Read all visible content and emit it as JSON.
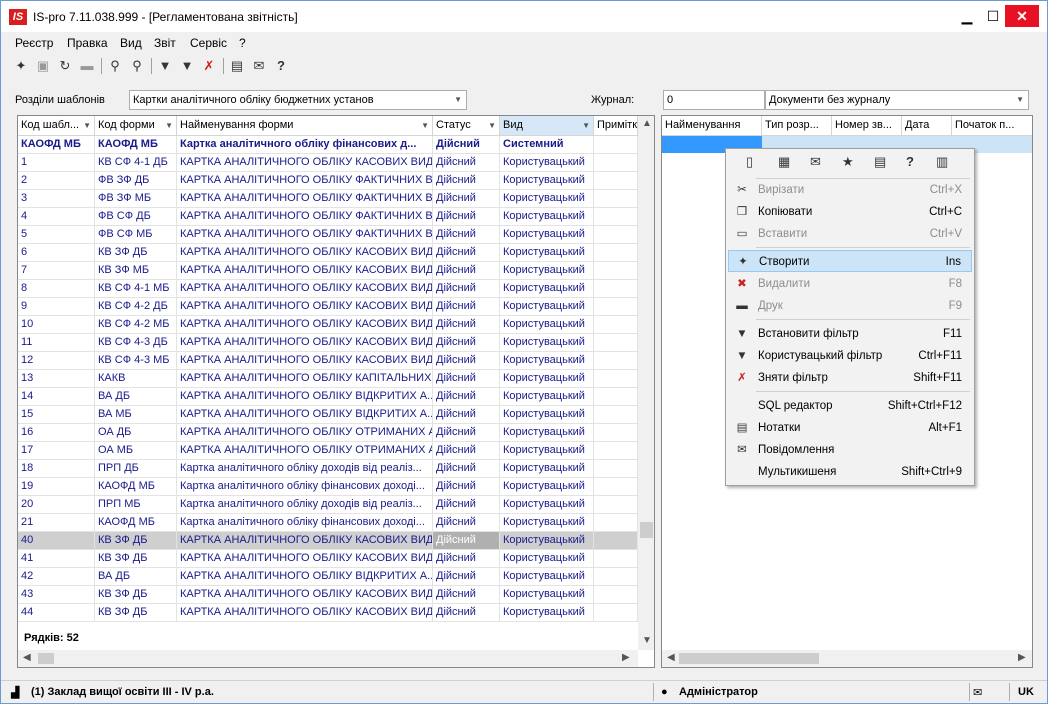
{
  "window": {
    "title": "IS-pro 7.11.038.999 - [Регламентована звітність]",
    "app_icon": "IS"
  },
  "menu": [
    "Реєстр",
    "Правка",
    "Вид",
    "Звіт",
    "Сервіс",
    "?"
  ],
  "filters": {
    "sections_label": "Розділи шаблонів",
    "sections_value": "Картки аналітичного обліку бюджетних установ",
    "journal_label": "Журнал:",
    "journal_num": "0",
    "journal_value": "Документи без журналу"
  },
  "left_grid": {
    "columns": [
      "Код шабл...",
      "Код форми",
      "Найменування форми",
      "Статус",
      "Вид",
      "Приміткa"
    ],
    "rows": [
      [
        "КАОФД МБ",
        "КАОФД МБ",
        "Картка аналітичного обліку фінансових д...",
        "Дійсний",
        "Системний"
      ],
      [
        "1",
        "КВ СФ 4-1 ДБ",
        "КАРТКА АНАЛІТИЧНОГО ОБЛІКУ КАСОВИХ ВИД...",
        "Дійсний",
        "Користувацький"
      ],
      [
        "2",
        "ФВ ЗФ ДБ",
        "КАРТКА АНАЛІТИЧНОГО ОБЛІКУ ФАКТИЧНИХ В...",
        "Дійсний",
        "Користувацький"
      ],
      [
        "3",
        "ФВ ЗФ МБ",
        "КАРТКА АНАЛІТИЧНОГО ОБЛІКУ ФАКТИЧНИХ В...",
        "Дійсний",
        "Користувацький"
      ],
      [
        "4",
        "ФВ СФ ДБ",
        "КАРТКА АНАЛІТИЧНОГО ОБЛІКУ ФАКТИЧНИХ В...",
        "Дійсний",
        "Користувацький"
      ],
      [
        "5",
        "ФВ СФ МБ",
        "КАРТКА АНАЛІТИЧНОГО ОБЛІКУ ФАКТИЧНИХ В...",
        "Дійсний",
        "Користувацький"
      ],
      [
        "6",
        "КВ ЗФ ДБ",
        "КАРТКА АНАЛІТИЧНОГО ОБЛІКУ КАСОВИХ ВИД...",
        "Дійсний",
        "Користувацький"
      ],
      [
        "7",
        "КВ ЗФ МБ",
        "КАРТКА АНАЛІТИЧНОГО ОБЛІКУ КАСОВИХ ВИД...",
        "Дійсний",
        "Користувацький"
      ],
      [
        "8",
        "КВ СФ 4-1 МБ",
        "КАРТКА АНАЛІТИЧНОГО ОБЛІКУ КАСОВИХ ВИД...",
        "Дійсний",
        "Користувацький"
      ],
      [
        "9",
        "КВ СФ 4-2 ДБ",
        "КАРТКА АНАЛІТИЧНОГО ОБЛІКУ КАСОВИХ ВИД...",
        "Дійсний",
        "Користувацький"
      ],
      [
        "10",
        "КВ СФ 4-2 МБ",
        "КАРТКА АНАЛІТИЧНОГО ОБЛІКУ КАСОВИХ ВИД...",
        "Дійсний",
        "Користувацький"
      ],
      [
        "11",
        "КВ СФ 4-3 ДБ",
        "КАРТКА АНАЛІТИЧНОГО ОБЛІКУ КАСОВИХ ВИД...",
        "Дійсний",
        "Користувацький"
      ],
      [
        "12",
        "КВ СФ 4-3 МБ",
        "КАРТКА АНАЛІТИЧНОГО ОБЛІКУ КАСОВИХ ВИД...",
        "Дійсний",
        "Користувацький"
      ],
      [
        "13",
        "КАКВ",
        "КАРТКА АНАЛІТИЧНОГО ОБЛІКУ КАПІТАЛЬНИХ...",
        "Дійсний",
        "Користувацький"
      ],
      [
        "14",
        "ВА ДБ",
        "КАРТКА АНАЛІТИЧНОГО ОБЛІКУ ВІДКРИТИХ А...",
        "Дійсний",
        "Користувацький"
      ],
      [
        "15",
        "ВА МБ",
        "КАРТКА АНАЛІТИЧНОГО ОБЛІКУ ВІДКРИТИХ А...",
        "Дійсний",
        "Користувацький"
      ],
      [
        "16",
        "ОА ДБ",
        "КАРТКА АНАЛІТИЧНОГО ОБЛІКУ ОТРИМАНИХ А...",
        "Дійсний",
        "Користувацький"
      ],
      [
        "17",
        "ОА МБ",
        "КАРТКА АНАЛІТИЧНОГО ОБЛІКУ ОТРИМАНИХ А...",
        "Дійсний",
        "Користувацький"
      ],
      [
        "18",
        "ПРП ДБ",
        "Картка аналітичного обліку доходів від реаліз...",
        "Дійсний",
        "Користувацький"
      ],
      [
        "19",
        "КАОФД МБ",
        "Картка аналітичного обліку фінансових доході...",
        "Дійсний",
        "Користувацький"
      ],
      [
        "20",
        "ПРП МБ",
        "Картка аналітичного обліку доходів від реаліз...",
        "Дійсний",
        "Користувацький"
      ],
      [
        "21",
        "КАОФД МБ",
        "Картка аналітичного обліку фінансових доході...",
        "Дійсний",
        "Користувацький"
      ],
      [
        "40",
        "КВ ЗФ ДБ",
        "КАРТКА АНАЛІТИЧНОГО ОБЛІКУ КАСОВИХ ВИД...",
        "Дійсний",
        "Користувацький"
      ],
      [
        "41",
        "КВ ЗФ ДБ",
        "КАРТКА АНАЛІТИЧНОГО ОБЛІКУ КАСОВИХ ВИД...",
        "Дійсний",
        "Користувацький"
      ],
      [
        "42",
        "ВА ДБ",
        "КАРТКА АНАЛІТИЧНОГО ОБЛІКУ ВІДКРИТИХ А...",
        "Дійсний",
        "Користувацький"
      ],
      [
        "43",
        "КВ ЗФ ДБ",
        "КАРТКА АНАЛІТИЧНОГО ОБЛІКУ КАСОВИХ ВИД...",
        "Дійсний",
        "Користувацький"
      ],
      [
        "44",
        "КВ ЗФ ДБ",
        "КАРТКА АНАЛІТИЧНОГО ОБЛІКУ КАСОВИХ ВИД...",
        "Дійсний",
        "Користувацький"
      ]
    ],
    "row_count_label": "Рядків: 52"
  },
  "right_grid": {
    "columns": [
      "Найменування",
      "Тип розр...",
      "Номер зв...",
      "Дата",
      "Початок п..."
    ]
  },
  "context_menu": {
    "icon_names": [
      "calculator-icon",
      "calendar-icon",
      "mail-icon",
      "star-icon",
      "notes-icon",
      "help-icon",
      "multipocket-icon"
    ],
    "items": [
      {
        "label": "Вирізати",
        "shortcut": "Ctrl+X",
        "icon": "cut-icon",
        "disabled": true
      },
      {
        "label": "Копіювати",
        "shortcut": "Ctrl+C",
        "icon": "copy-icon",
        "disabled": false
      },
      {
        "label": "Вставити",
        "shortcut": "Ctrl+V",
        "icon": "paste-icon",
        "disabled": true
      },
      {
        "label": "Створити",
        "shortcut": "Ins",
        "icon": "create-icon",
        "disabled": false,
        "highlighted": true
      },
      {
        "label": "Видалити",
        "shortcut": "F8",
        "icon": "delete-icon",
        "disabled": true
      },
      {
        "label": "Друк",
        "shortcut": "F9",
        "icon": "print-icon",
        "disabled": true
      },
      {
        "label": "Встановити фільтр",
        "shortcut": "F11",
        "icon": "filter-icon",
        "disabled": false
      },
      {
        "label": "Користувацький фільтр",
        "shortcut": "Ctrl+F11",
        "icon": "user-filter-icon",
        "disabled": false
      },
      {
        "label": "Зняти фільтр",
        "shortcut": "Shift+F11",
        "icon": "clear-filter-icon",
        "disabled": false
      },
      {
        "label": "SQL редактор",
        "shortcut": "Shift+Ctrl+F12",
        "icon": "sql-icon",
        "disabled": false
      },
      {
        "label": "Нотатки",
        "shortcut": "Alt+F1",
        "icon": "notes-icon",
        "disabled": false
      },
      {
        "label": "Повідомлення",
        "shortcut": "",
        "icon": "mail-icon",
        "disabled": false
      },
      {
        "label": "Мультикишеня",
        "shortcut": "Shift+Ctrl+9",
        "icon": "multipocket-icon",
        "disabled": false
      }
    ]
  },
  "status": {
    "org": "(1) Заклад вищої освіти III - IV р.а.",
    "user": "Адміністратор",
    "lang": "UK"
  }
}
